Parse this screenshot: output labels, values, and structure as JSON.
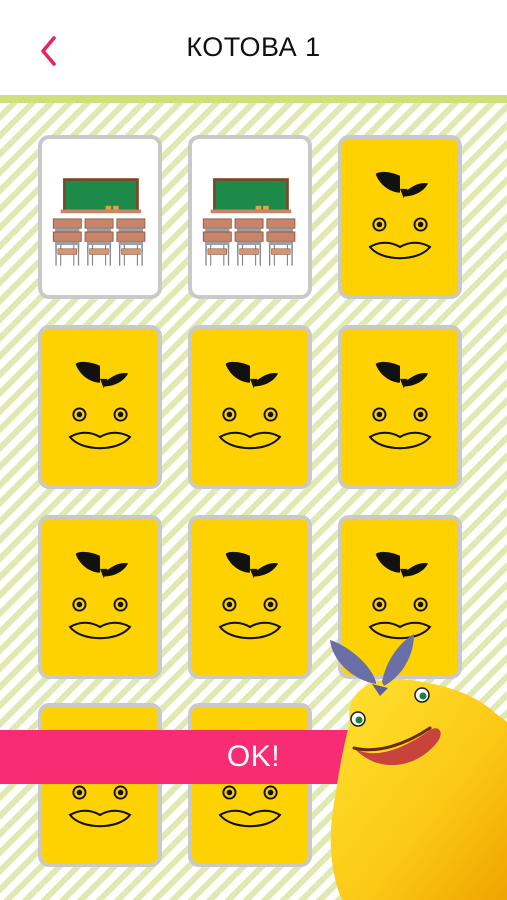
{
  "header": {
    "title": "КОТОВА 1",
    "back_icon": "chevron-left-icon",
    "accent_color": "#e8245c"
  },
  "board": {
    "columns": 3,
    "cards": [
      {
        "state": "face-up",
        "picture": "classroom"
      },
      {
        "state": "face-up",
        "picture": "classroom"
      },
      {
        "state": "face-down"
      },
      {
        "state": "face-down"
      },
      {
        "state": "face-down"
      },
      {
        "state": "face-down"
      },
      {
        "state": "face-down"
      },
      {
        "state": "face-down"
      },
      {
        "state": "face-down"
      },
      {
        "state": "face-down"
      },
      {
        "state": "face-down"
      }
    ],
    "card_back_color": "#fed200",
    "stripe_color": "#dfe9b2"
  },
  "banner": {
    "label": "OK!",
    "color": "#f72c73"
  },
  "mascot": {
    "icon": "yellow-mascot-character"
  }
}
